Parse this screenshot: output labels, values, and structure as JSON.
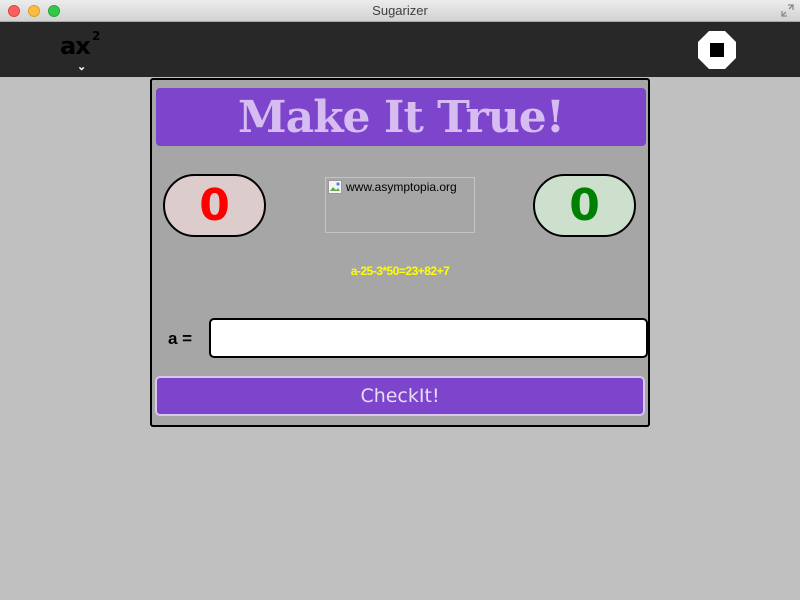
{
  "window": {
    "title": "Sugarizer"
  },
  "toolbar": {
    "activity_icon": {
      "base": "ax",
      "superscript": "2",
      "name": "math-ax2-icon"
    },
    "stop_icon": "stop-icon"
  },
  "game": {
    "banner": "Make It True!",
    "score_left": "0",
    "score_right": "0",
    "image_alt": "www.asymptopia.org",
    "equation": "a-25-3*50=23+82+7",
    "variable_label": "a =",
    "answer_value": "",
    "check_button": "CheckIt!"
  },
  "colors": {
    "banner_bg": "#7c45cc",
    "banner_text": "#d6bcf1",
    "score_left": "#ff0000",
    "score_right": "#008000",
    "equation": "#ffff00",
    "panel_bg": "#a6a6a6",
    "toolbar_bg": "#282828"
  }
}
